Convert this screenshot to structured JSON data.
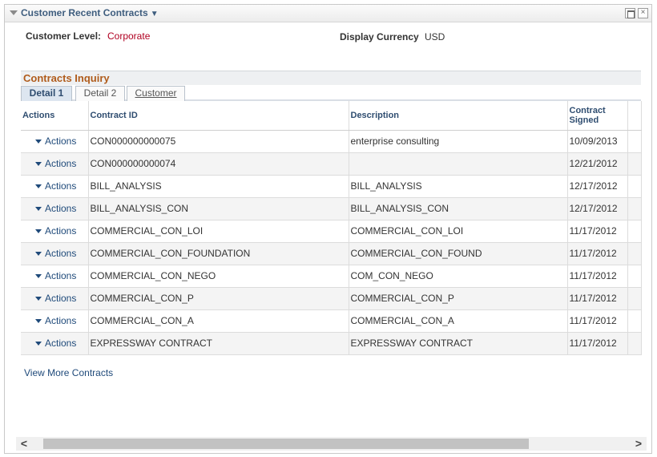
{
  "pagelet": {
    "title": "Customer Recent Contracts",
    "menu_icon": "dropdown-triangle-icon",
    "maximize_icon": "maximize-icon",
    "close_label": "×"
  },
  "fields": {
    "customer_level_label": "Customer Level:",
    "customer_level_value": "Corporate",
    "display_currency_label": "Display Currency",
    "display_currency_value": "USD"
  },
  "group": {
    "title": "Contracts Inquiry",
    "tabs": [
      {
        "label": "Detail 1",
        "active": true
      },
      {
        "label": "Detail 2",
        "active": false
      },
      {
        "label": "Customer",
        "active": false
      }
    ]
  },
  "grid": {
    "columns": [
      "Actions",
      "Contract ID",
      "Description",
      "Contract Signed"
    ],
    "action_label": "Actions",
    "rows": [
      {
        "contract_id": "CON000000000075",
        "description": "enterprise consulting",
        "signed": "10/09/2013"
      },
      {
        "contract_id": "CON000000000074",
        "description": "",
        "signed": "12/21/2012"
      },
      {
        "contract_id": "BILL_ANALYSIS",
        "description": "BILL_ANALYSIS",
        "signed": "12/17/2012"
      },
      {
        "contract_id": "BILL_ANALYSIS_CON",
        "description": "BILL_ANALYSIS_CON",
        "signed": "12/17/2012"
      },
      {
        "contract_id": "COMMERCIAL_CON_LOI",
        "description": "COMMERCIAL_CON_LOI",
        "signed": "11/17/2012"
      },
      {
        "contract_id": "COMMERCIAL_CON_FOUNDATION",
        "description": "COMMERCIAL_CON_FOUND",
        "signed": "11/17/2012"
      },
      {
        "contract_id": "COMMERCIAL_CON_NEGO",
        "description": "COM_CON_NEGO",
        "signed": "11/17/2012"
      },
      {
        "contract_id": "COMMERCIAL_CON_P",
        "description": "COMMERCIAL_CON_P",
        "signed": "11/17/2012"
      },
      {
        "contract_id": "COMMERCIAL_CON_A",
        "description": "COMMERCIAL_CON_A",
        "signed": "11/17/2012"
      },
      {
        "contract_id": "EXPRESSWAY CONTRACT",
        "description": "EXPRESSWAY CONTRACT",
        "signed": "11/17/2012"
      }
    ]
  },
  "links": {
    "view_more": "View More Contracts"
  },
  "scrollbar": {
    "left_glyph": "<",
    "right_glyph": ">",
    "position": 0.0
  },
  "colors": {
    "title_blue": "#3e5d7e",
    "link_blue": "#1f4a7a",
    "value_red": "#b00021",
    "group_title_orange": "#b05c1c"
  }
}
